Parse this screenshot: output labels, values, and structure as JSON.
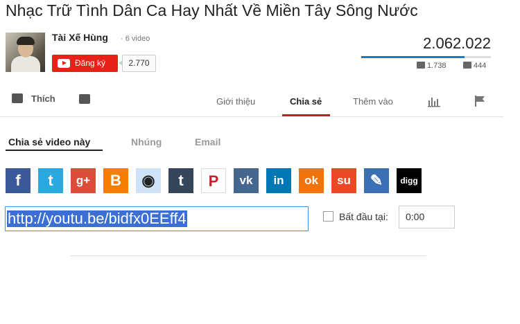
{
  "video": {
    "title": "Nhạc Trữ Tình Dân Ca Hay Nhất Về Miền Tây Sông Nước",
    "views": "2.062.022",
    "likes": "1.738",
    "dislikes": "444",
    "like_ratio": 0.796
  },
  "channel": {
    "name": "Tài Xế Hùng",
    "video_count": "· 6 video",
    "subscribe_label": "Đăng ký",
    "subscriber_count": "2.770"
  },
  "actions": {
    "like_label": "Thích",
    "tabs": [
      "Giới thiệu",
      "Chia sẻ",
      "Thêm vào"
    ],
    "active_tab": "Chia sẻ"
  },
  "share": {
    "subtabs": [
      "Chia sẻ video này",
      "Nhúng",
      "Email"
    ],
    "active_subtab": "Chia sẻ video này",
    "url": "http://youtu.be/bidfx0EEff4",
    "start_label": "Bất đầu tại:",
    "start_time": "0:00",
    "start_checked": false,
    "social": [
      {
        "name": "facebook-icon",
        "glyph": "f",
        "color": "#3b5998"
      },
      {
        "name": "twitter-icon",
        "glyph": "t",
        "color": "#2aa9e0"
      },
      {
        "name": "google-plus-icon",
        "glyph": "g+",
        "color": "#dd4b39"
      },
      {
        "name": "blogger-icon",
        "glyph": "B",
        "color": "#f57d00"
      },
      {
        "name": "reddit-icon",
        "glyph": "◉",
        "color": "#cee3f8"
      },
      {
        "name": "tumblr-icon",
        "glyph": "t",
        "color": "#35465c"
      },
      {
        "name": "pinterest-icon",
        "glyph": "P",
        "color": "#ffffff"
      },
      {
        "name": "vk-icon",
        "glyph": "vk",
        "color": "#45668e"
      },
      {
        "name": "linkedin-icon",
        "glyph": "in",
        "color": "#0077b5"
      },
      {
        "name": "odnoklassniki-icon",
        "glyph": "ok",
        "color": "#f2720c"
      },
      {
        "name": "stumbleupon-icon",
        "glyph": "su",
        "color": "#eb4924"
      },
      {
        "name": "livejournal-icon",
        "glyph": "✎",
        "color": "#3c70b5"
      },
      {
        "name": "digg-icon",
        "glyph": "digg",
        "color": "#000000"
      }
    ]
  }
}
